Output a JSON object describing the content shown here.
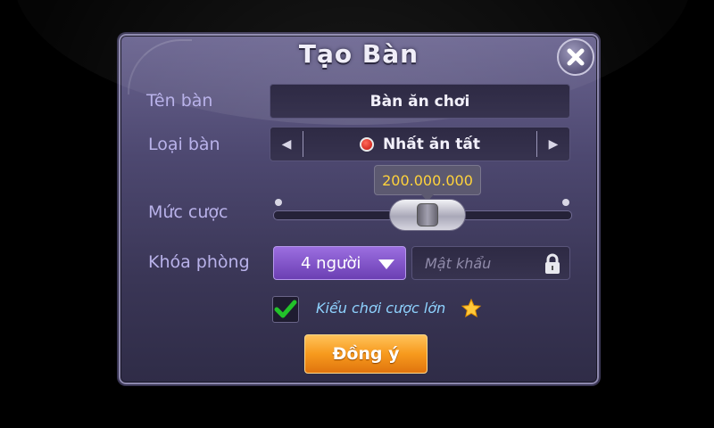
{
  "dialog": {
    "title": "Tạo Bàn",
    "close_icon": "close-x-icon"
  },
  "form": {
    "table_name_label": "Tên bàn",
    "table_name_value": "Bàn ăn chơi",
    "table_type_label": "Loại bàn",
    "table_type_value": "Nhất ăn tất",
    "bet_label": "Mức cược",
    "bet_value": "200.000.000",
    "bet_slider_fraction": 0.52,
    "lock_label": "Khóa phòng",
    "players_value": "4 người",
    "password_placeholder": "Mật khẩu",
    "high_bet_label": "Kiểu chơi cược lớn",
    "high_bet_checked": true,
    "confirm_label": "Đồng ý"
  },
  "colors": {
    "accent_purple": "#7d52c8",
    "confirm_orange": "#f79a1d",
    "tooltip_text": "#ffd33b",
    "label_text": "#b9b2ea",
    "check_green": "#22c22a"
  }
}
